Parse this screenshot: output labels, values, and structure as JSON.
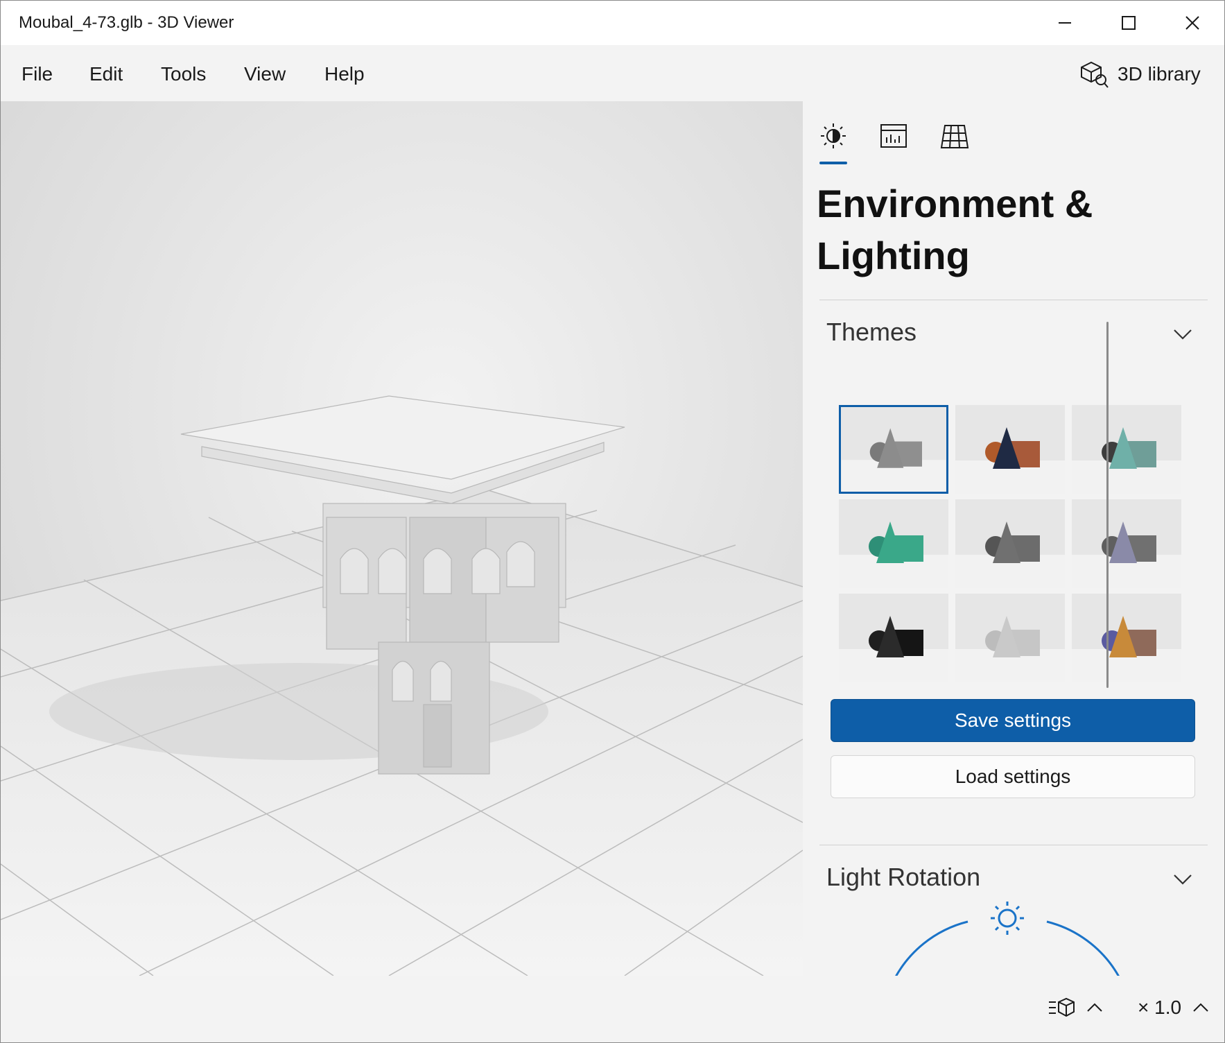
{
  "window": {
    "title": "Moubal_4-73.glb - 3D Viewer"
  },
  "menu": {
    "items": [
      "File",
      "Edit",
      "Tools",
      "View",
      "Help"
    ],
    "library_label": "3D library"
  },
  "panel": {
    "tabs": [
      "environment-lighting",
      "stats-shading",
      "mesh-grid"
    ],
    "title": "Environment & Lighting",
    "themes": {
      "label": "Themes",
      "selected_index": 0,
      "items": [
        {
          "bg": "#e6e6e6",
          "cone": "#8c8c8c",
          "sphere": "#7a7a7a",
          "box": "#8f8f8f"
        },
        {
          "bg": "#e6e6e6",
          "cone": "#1f2a44",
          "sphere": "#b05a2a",
          "box": "#a85a3a"
        },
        {
          "bg": "#e6e6e6",
          "cone": "#6fb0a8",
          "sphere": "#3d3d3d",
          "box": "#6f9e98"
        },
        {
          "bg": "#e6e6e6",
          "cone": "#3aa889",
          "sphere": "#2e8f77",
          "box": "#3aa889"
        },
        {
          "bg": "#e6e6e6",
          "cone": "#707070",
          "sphere": "#555555",
          "box": "#6c6c6c"
        },
        {
          "bg": "#e6e6e6",
          "cone": "#8a8aa8",
          "sphere": "#5f5f5f",
          "box": "#707070"
        },
        {
          "bg": "#e6e6e6",
          "cone": "#2b2b2b",
          "sphere": "#1f1f1f",
          "box": "#151515"
        },
        {
          "bg": "#e6e6e6",
          "cone": "#c9c9c9",
          "sphere": "#bcbcbc",
          "box": "#c6c6c6"
        },
        {
          "bg": "#e6e6e6",
          "cone": "#c88a3a",
          "sphere": "#5a5aa0",
          "box": "#8f6a5a"
        }
      ]
    },
    "save_label": "Save settings",
    "load_label": "Load settings",
    "light_rotation_label": "Light Rotation"
  },
  "status": {
    "zoom": "× 1.0"
  },
  "colors": {
    "accent": "#0e5ea8",
    "dial": "#1a73c8"
  }
}
